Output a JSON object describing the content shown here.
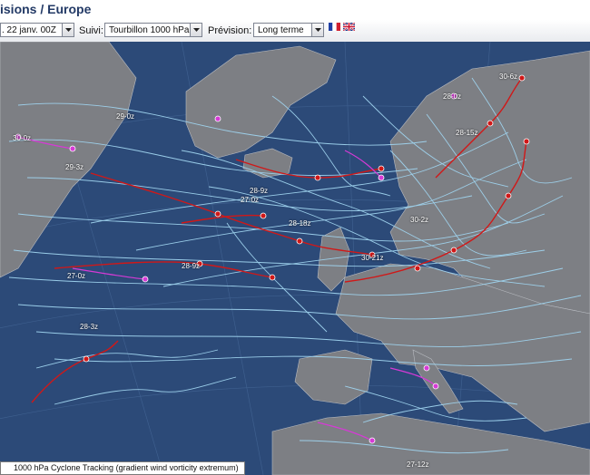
{
  "header": {
    "title": "isions / Europe"
  },
  "toolbar": {
    "run": ". 22 janv. 00Z",
    "suivi_label": "Suivi:",
    "suivi_value": "Tourbillon 1000 hPa",
    "prevision_label": "Prévision:",
    "prevision_value": "Long terme",
    "flags": [
      "fr-flag-icon",
      "uk-flag-icon"
    ]
  },
  "map": {
    "caption": "1000 hPa Cyclone Tracking (gradient wind vorticity extremum)",
    "colors": {
      "ocean": "#2c4a78",
      "land": "#7a7a7a",
      "track_light": "#9fd3ee",
      "track_red": "#d01818",
      "track_magenta": "#d63ad6"
    },
    "track_labels": [
      "29-0z",
      "30-0z",
      "29-3z",
      "27-0z",
      "28-9z",
      "28-18z",
      "27-0z",
      "28-9z",
      "28-3z",
      "30-6z",
      "28-0z",
      "28-15z",
      "30-2z",
      "30-21z",
      "27-12z"
    ]
  }
}
